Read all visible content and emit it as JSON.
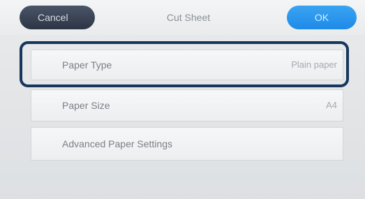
{
  "header": {
    "cancel_label": "Cancel",
    "title": "Cut Sheet",
    "ok_label": "OK"
  },
  "menu": {
    "items": [
      {
        "label": "Paper Type",
        "value": "Plain paper"
      },
      {
        "label": "Paper Size",
        "value": "A4"
      },
      {
        "label": "Advanced Paper Settings",
        "value": ""
      }
    ]
  },
  "colors": {
    "cancel_button": "#2f3a4b",
    "ok_button": "#2291ec",
    "highlight_frame": "#16365e"
  }
}
